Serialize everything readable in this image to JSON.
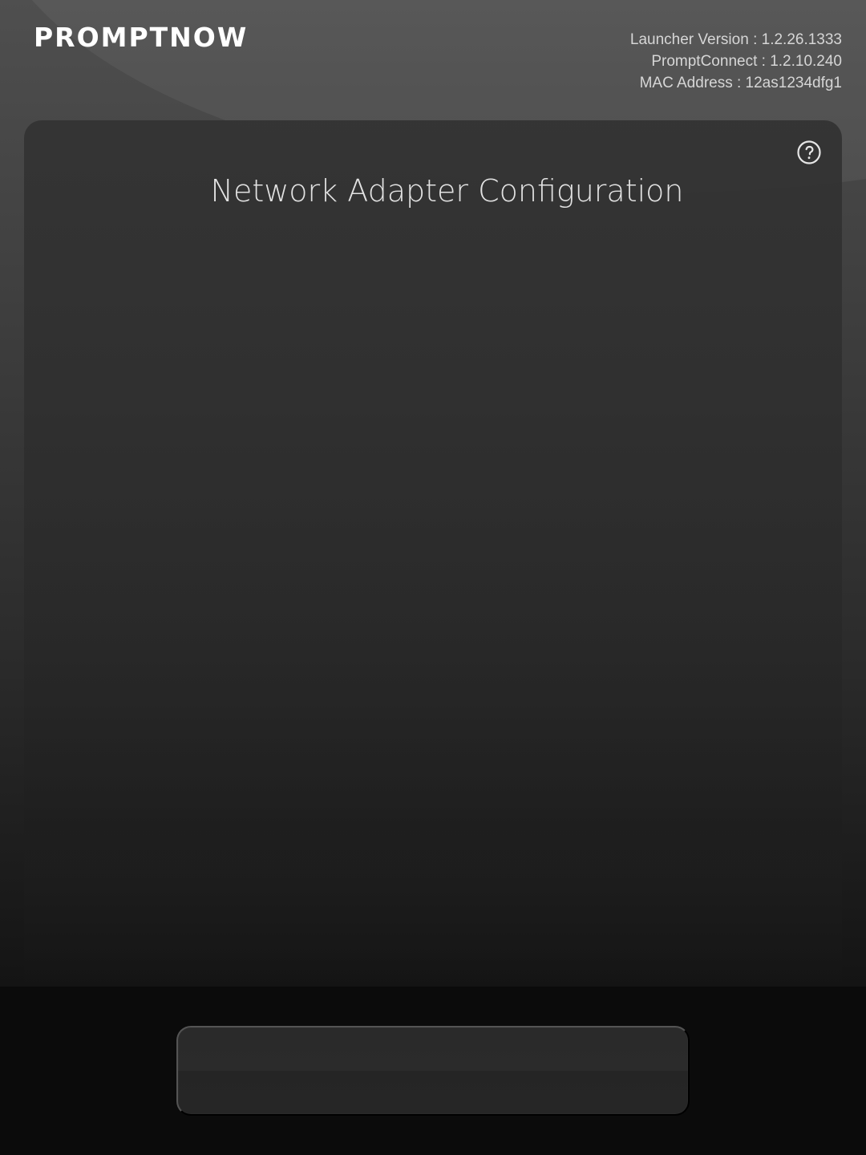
{
  "header": {
    "brand": "PROMPTNOW",
    "launcher_version": "Launcher Version : 1.2.26.1333",
    "prompt_connect": "PromptConnect : 1.2.10.240",
    "mac_address": "MAC Address : 12as1234dfg1"
  },
  "panel": {
    "title": "Network Adapter Configuration",
    "help_icon": "help-circle-icon"
  },
  "bottom": {
    "button_label": ""
  },
  "theme": {
    "background_top": "#4f4f4f",
    "background_bottom": "#0b0b0b",
    "panel": "#333333",
    "text_primary": "#e2e2e2",
    "text_secondary": "#d6d6d6"
  }
}
